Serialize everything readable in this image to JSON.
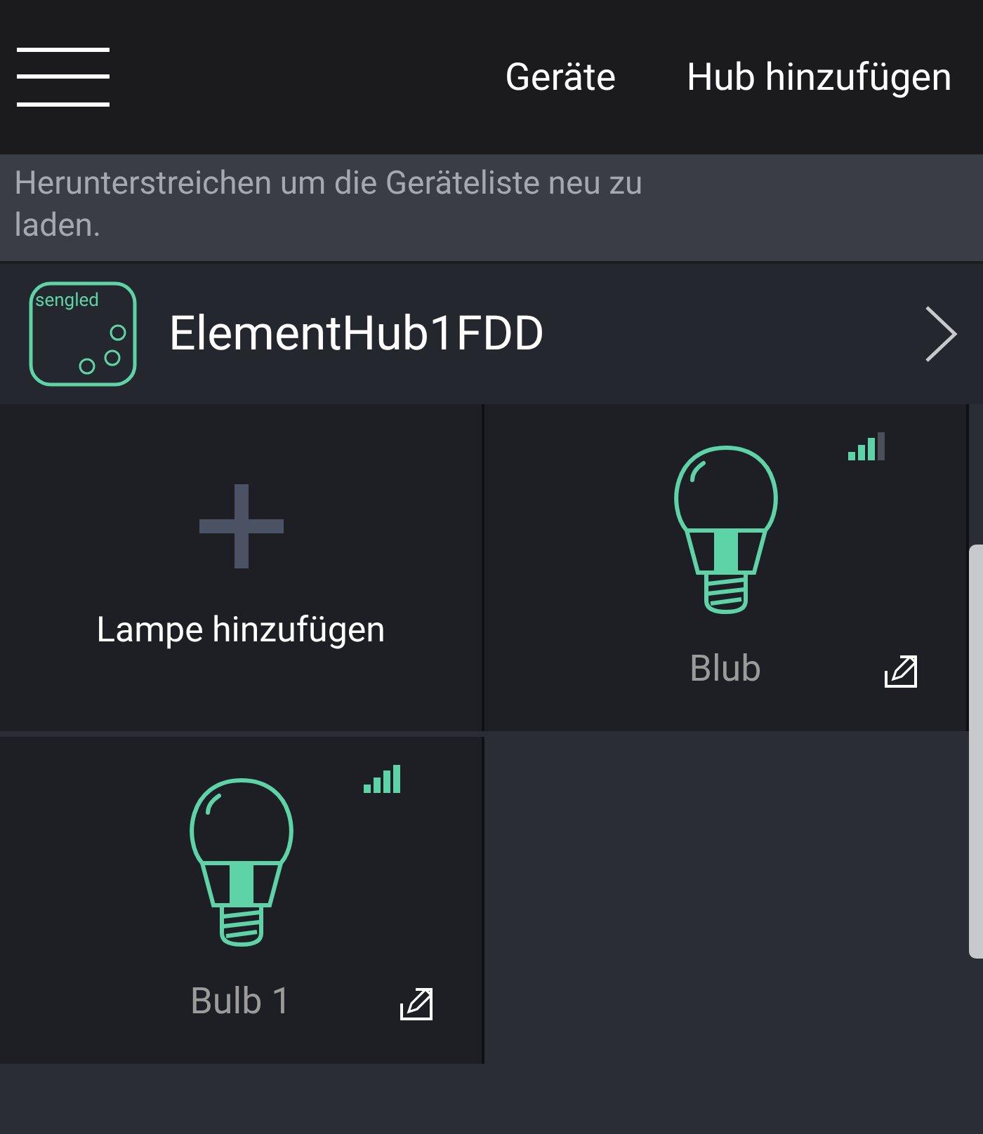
{
  "nav": {
    "links": [
      "Geräte",
      "Hub hinzufügen"
    ]
  },
  "hint": "Herunterstreichen um die Geräteliste neu zu laden.",
  "hub": {
    "logo_text": "sengled",
    "name": "ElementHub1FDD"
  },
  "tiles": [
    {
      "kind": "add",
      "label": "Lampe hinzufügen"
    },
    {
      "kind": "bulb",
      "name": "Blub",
      "signal_full": false
    },
    {
      "kind": "bulb",
      "name": "Bulb 1",
      "signal_full": true
    }
  ]
}
